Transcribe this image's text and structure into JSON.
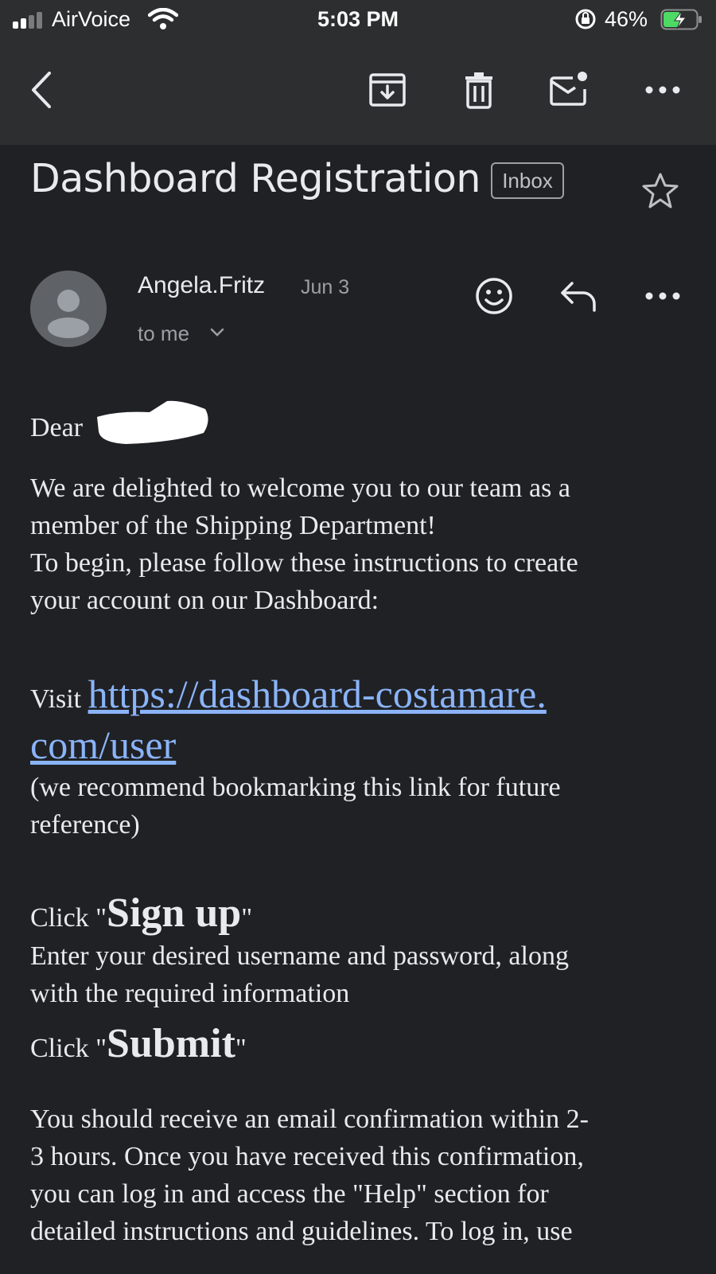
{
  "status_bar": {
    "carrier": "AirVoice",
    "time": "5:03 PM",
    "battery": "46%"
  },
  "email": {
    "subject": "Dashboard Registration",
    "label": "Inbox",
    "sender": "Angela.Fritz",
    "date": "Jun 3",
    "recipient": "to me"
  },
  "body": {
    "greeting": "Dear",
    "intro_line1": "We are delighted to welcome you to our team as a",
    "intro_line2": "member of the Shipping Department!",
    "intro_line3": "To begin, please follow these instructions to create",
    "intro_line4": "your account on our Dashboard:",
    "visit": "Visit",
    "link_line1": "https://dashboard-costamare.",
    "link_line2": "com/user",
    "bookmark_line1": "(we recommend bookmarking this link for future",
    "bookmark_line2": "reference)",
    "click1_prefix": "Click \"",
    "click1_action": "Sign up",
    "click1_suffix": "\"",
    "enter_line1": "Enter your desired username and password, along",
    "enter_line2": "with the required information",
    "click2_prefix": "Click \"",
    "click2_action": "Submit",
    "click2_suffix": "\"",
    "confirm_line1": "You should receive an email confirmation within 2-",
    "confirm_line2": "3 hours. Once you have received this confirmation,",
    "confirm_line3": "you can log in and access the \"Help\" section for",
    "confirm_line4": "detailed instructions and guidelines. To log in, use"
  },
  "icons": [
    "signal-icon",
    "wifi-icon",
    "lock-rotation-icon",
    "battery-icon",
    "back-icon",
    "archive-icon",
    "trash-icon",
    "mark-unread-icon",
    "more-icon",
    "star-icon",
    "avatar-icon",
    "emoji-icon",
    "reply-icon"
  ],
  "colors": {
    "background": "#202125",
    "toolbar": "#2d2e30",
    "link": "#8ab4f8"
  }
}
